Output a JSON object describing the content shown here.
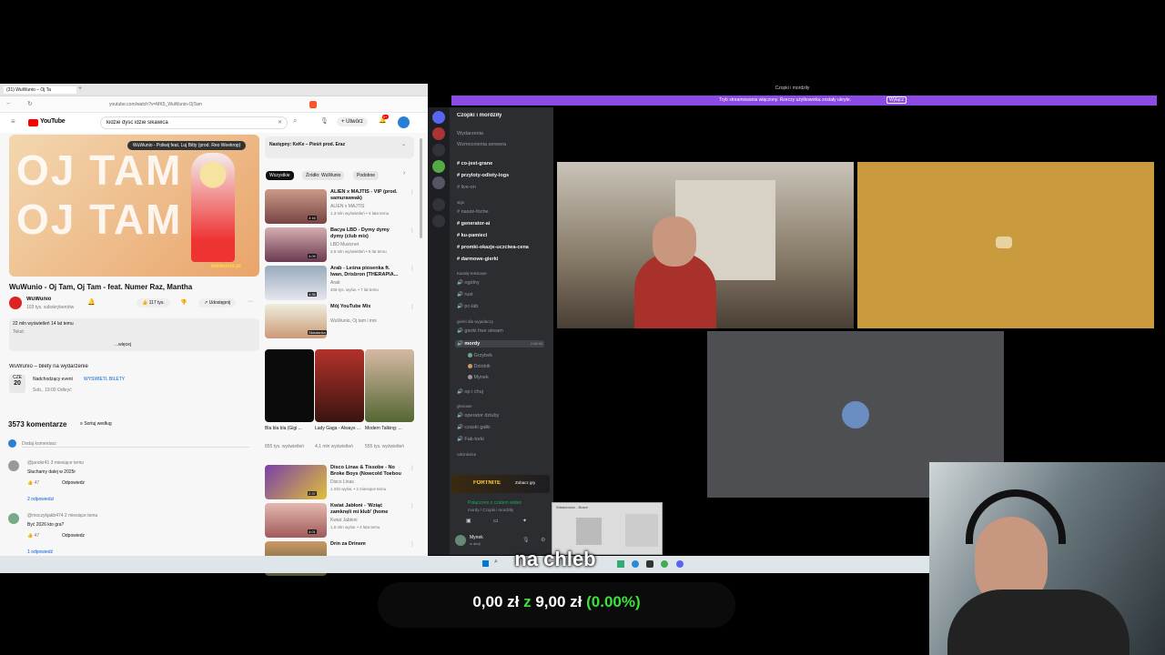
{
  "youtube": {
    "tab_title": "(31) WuWunio – Oj Ta",
    "url": "youtube.com/watch?v=MK5_WuWunio-OjTam",
    "logo_text": "YouTube",
    "search_value": "kidzie dysc idzie sikawica",
    "create_label": "Utwórz",
    "notif_count": "9+",
    "now_playing_banner": "WuWunio - Poliwij feat. Luj Bitty (prod. Reo Weekrop)",
    "video_title": "WuWunio - Oj Tam, Oj Tam - feat. Numer Raz, Mantha",
    "thumb_text_line1": "OJ TAM",
    "thumb_text_line2": "OJ TAM",
    "thumb_corner": "wuwunio.pl",
    "channel_name": "WuWunio",
    "subscribers": "103 tys. subskrybentów",
    "likes": "117 tys.",
    "share_label": "Udostępnij",
    "views_line": "22 mln wyświetleń  14 lat temu",
    "desc_tekst": "Tekst:",
    "desc_more": "...więcej",
    "tickets_title": "WuWunio – bilety na wydarzenie",
    "event_month": "CZE",
    "event_day": "20",
    "event_place": "Nadchodzący event",
    "event_link": "WYŚWIETL BILETY",
    "event_time": "Sob., 19:00 Odkryć",
    "comments_count": "3573 komentarze",
    "sort_label": "Sortuj według",
    "add_comment": "Dodaj komentarz",
    "comments": [
      {
        "user": "@janokr41  3 miesiące temu",
        "text": "Słuchamy dalej w 2025r",
        "likes": "47",
        "reply": "Odpowiedz",
        "replies": "2 odpowiedzi"
      },
      {
        "user": "@moczykjakb474  2 miesiące temu",
        "text": "Być 2026 kto gra?",
        "likes": "47",
        "reply": "Odpowiedz",
        "replies": "1 odpowiedź"
      }
    ],
    "next_label": "Następny: KeKe – Pieśń prod. Eraz",
    "filters": [
      "Wszystkie",
      "Źródło: WuWunio",
      "Podobne"
    ],
    "recs": [
      {
        "title": "ALIEN x MAJTIS - VIP (prod. samuraweak)",
        "channel": "ALIEN x MAJTIS",
        "meta": "1,3 mln wyświetleń • 4 lata temu",
        "dur": "3:16"
      },
      {
        "title": "Bacya LBD - Dymy dymy dymy (club mix)",
        "channel": "LBD Musicnet",
        "meta": "2,6 mln wyświetleń • 6 lat temu",
        "dur": "4:09"
      },
      {
        "title": "Arab - Leśna piosenka ft. Iwan, Drisbron [THERAPIA...",
        "channel": "Arab",
        "meta": "406 tys. wyśw. • 7 lat temu",
        "dur": "4:35"
      },
      {
        "title": "Mój YouTube Mix",
        "channel": "WuWunio, Oj tam i inni",
        "meta": "",
        "dur": "Składanka"
      }
    ],
    "shorts": [
      {
        "title": "Bla bla bla (Gigi ...",
        "meta": "855 tys. wyświetleń"
      },
      {
        "title": "Lady Gaga - Always ...",
        "meta": "4,1 mln wyświetleń"
      },
      {
        "title": "Modern Talking: ...",
        "meta": "555 tys. wyświetleń"
      }
    ],
    "recs2": [
      {
        "title": "Disco Linas & Tissobe - No Broke Boys (Nowcold Toebou ...",
        "channel": "Disco Linas",
        "meta": "1 mln wyśw. • 2 miesiące temu",
        "dur": "2:37"
      },
      {
        "title": "Kwiat Jabłoni - 'Wziąć zamknęli mi klub' (home edition)",
        "channel": "Kwiat Jabłoni",
        "meta": "1,6 mln wyśw. • 4 lata temu",
        "dur": "4:01"
      },
      {
        "title": "Drin za Drinem",
        "channel": "",
        "meta": "",
        "dur": ""
      }
    ]
  },
  "discord": {
    "window_title": "Czopki i mordziły",
    "banner_text": "Tryb streamowania włączony. Rzeczy użytkownika zostały ukryte.",
    "banner_button": "Wyłącz",
    "server_name": "Czopki i mordziły",
    "top_items": [
      "Wydarzenia",
      "Wzmocnienia serwera"
    ],
    "text_channels": [
      "co-jest-grane",
      "przyloty-odloty-logs",
      "live-on"
    ],
    "category1": "sigs",
    "channels2": [
      "nasze-foche",
      "generator-ai",
      "ku-pamieci",
      "promki-okazje-uczciwa-cena",
      "darmowe-gierki"
    ],
    "voice_category": "Kanały tekstowe",
    "voice_channels": [
      "ogólny",
      "rust",
      "pc-lab"
    ],
    "voice_category2": "gierki dla wyjadaczy",
    "voice_channels2": [
      "gierki free stream",
      "mordy",
      "Grzybek",
      "Dziobik",
      "Mynek",
      "op i chuj"
    ],
    "voice_category3": "głosowe",
    "voice_channels3": [
      "operator dziuby",
      "czaski gałki",
      "Fak-torki"
    ],
    "other_category": "odcinkolce",
    "game_banner": "FORTNITE",
    "game_button": "Zobacz gry",
    "voice_status": "Połączono z czatem wideo",
    "voice_sub": "mordy / Czopki i mordziły",
    "user_name": "Mynek",
    "user_status": "w akcji",
    "time_label": "2:46:40",
    "preview_label": "Wiadomość - Brave"
  },
  "overlay": {
    "caption": "na chleb",
    "donation_amount": "0,00 zł",
    "donation_of": "z",
    "donation_goal": "9,00 zł",
    "donation_percent": "(0.00%)"
  },
  "colors": {
    "discord_banner": "#8c4ae6",
    "discord_tile": "#c99a3e",
    "youtube_red": "#ff0000",
    "progress_green": "#3be23b"
  }
}
